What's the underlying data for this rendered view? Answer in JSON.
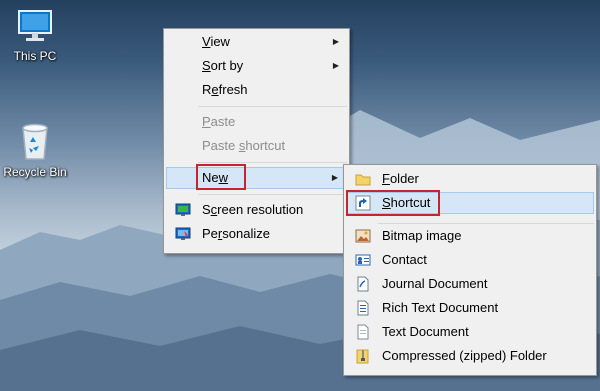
{
  "desktop": {
    "icons": [
      {
        "label": "This PC",
        "icon": "this-pc-icon"
      },
      {
        "label": "Recycle Bin",
        "icon": "recycle-bin-icon"
      }
    ]
  },
  "context_menu": {
    "items": [
      {
        "label": "View",
        "accel": "V",
        "rest": "iew",
        "submenu": true
      },
      {
        "label": "Sort by",
        "accel": "S",
        "rest": "ort by",
        "submenu": true
      },
      {
        "label": "Refresh",
        "pre": "R",
        "accel": "e",
        "rest": "fresh"
      },
      {
        "label": "Paste",
        "accel": "P",
        "rest": "aste",
        "disabled": true
      },
      {
        "label": "Paste shortcut",
        "pre": "Paste ",
        "accel": "s",
        "rest": "hortcut",
        "disabled": true
      },
      {
        "label": "New",
        "pre": "Ne",
        "accel": "w",
        "rest": "",
        "submenu": true,
        "highlighted": true
      },
      {
        "label": "Screen resolution",
        "pre": "S",
        "accel": "c",
        "rest": "reen resolution",
        "icon": "screen-resolution-icon"
      },
      {
        "label": "Personalize",
        "pre": "Pe",
        "accel": "r",
        "rest": "sonalize",
        "icon": "personalize-icon"
      }
    ]
  },
  "new_submenu": {
    "items": [
      {
        "label": "Folder",
        "accel": "F",
        "rest": "older",
        "icon": "folder-icon"
      },
      {
        "label": "Shortcut",
        "accel": "S",
        "rest": "hortcut",
        "icon": "shortcut-icon",
        "highlighted": true
      },
      {
        "label": "Bitmap image",
        "icon": "bitmap-image-icon"
      },
      {
        "label": "Contact",
        "icon": "contact-icon"
      },
      {
        "label": "Journal Document",
        "icon": "journal-document-icon"
      },
      {
        "label": "Rich Text Document",
        "icon": "rich-text-document-icon"
      },
      {
        "label": "Text Document",
        "icon": "text-document-icon"
      },
      {
        "label": "Compressed (zipped) Folder",
        "icon": "compressed-folder-icon"
      }
    ]
  },
  "colors": {
    "highlight_fill": "#d5e6f7",
    "highlight_border": "#a6c8ec",
    "annotation_red": "#c0282e",
    "menu_bg": "#f0f0f0"
  }
}
